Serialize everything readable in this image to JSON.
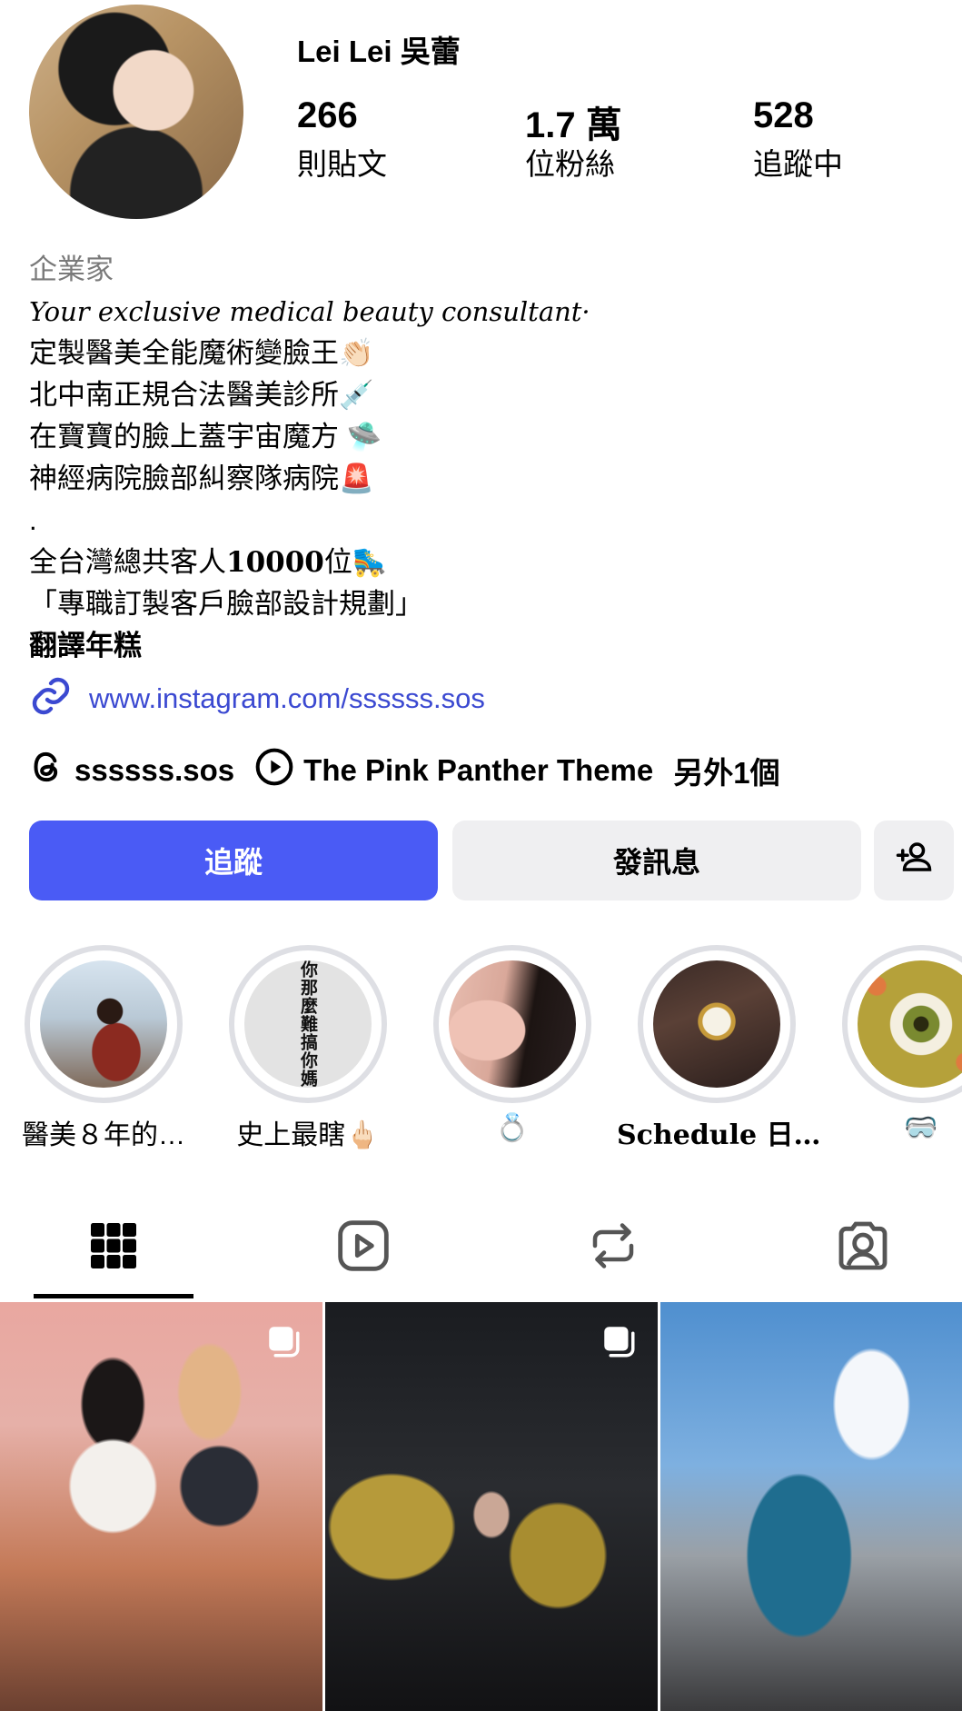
{
  "profile": {
    "username": "Lei Lei 吳蕾",
    "stats": [
      {
        "value": "266",
        "label": "則貼文"
      },
      {
        "value": "1.7 萬",
        "label": "位粉絲"
      },
      {
        "value": "528",
        "label": "追蹤中"
      }
    ]
  },
  "bio": {
    "category": "企業家",
    "lines": [
      "Your exclusive medical beauty consultant·",
      "定製醫美全能魔術變臉王👏🏻",
      "北中南正規合法醫美診所💉",
      "在寶寶的臉上蓋宇宙魔方 🛸",
      "神經病院臉部糾察隊病院🚨",
      ".",
      "全台灣總共客人",
      "10000",
      "位🛼",
      "「專職訂製客戶臉部設計規劃」",
      "翻譯年糕"
    ],
    "link": "www.instagram.com/ssssss.sos"
  },
  "meta": {
    "threads": "ssssss.sos",
    "music": "The Pink Panther Theme",
    "more": "另外1個"
  },
  "buttons": {
    "follow": "追蹤",
    "message": "發訊息"
  },
  "highlights": [
    {
      "label": "醫美８年的…"
    },
    {
      "label": "史上最瞎🖕🏻"
    },
    {
      "label": "💍"
    },
    {
      "label": "Schedule 日…"
    },
    {
      "label": "🥽"
    }
  ],
  "highlight_text": "你那麼難搞你媽",
  "tabs": [
    "grid-icon",
    "reels-icon",
    "reposts-icon",
    "tagged-icon"
  ],
  "colors": {
    "accent": "#4a5bf5",
    "link": "#3b49d1",
    "button_bg": "#efeff1"
  }
}
